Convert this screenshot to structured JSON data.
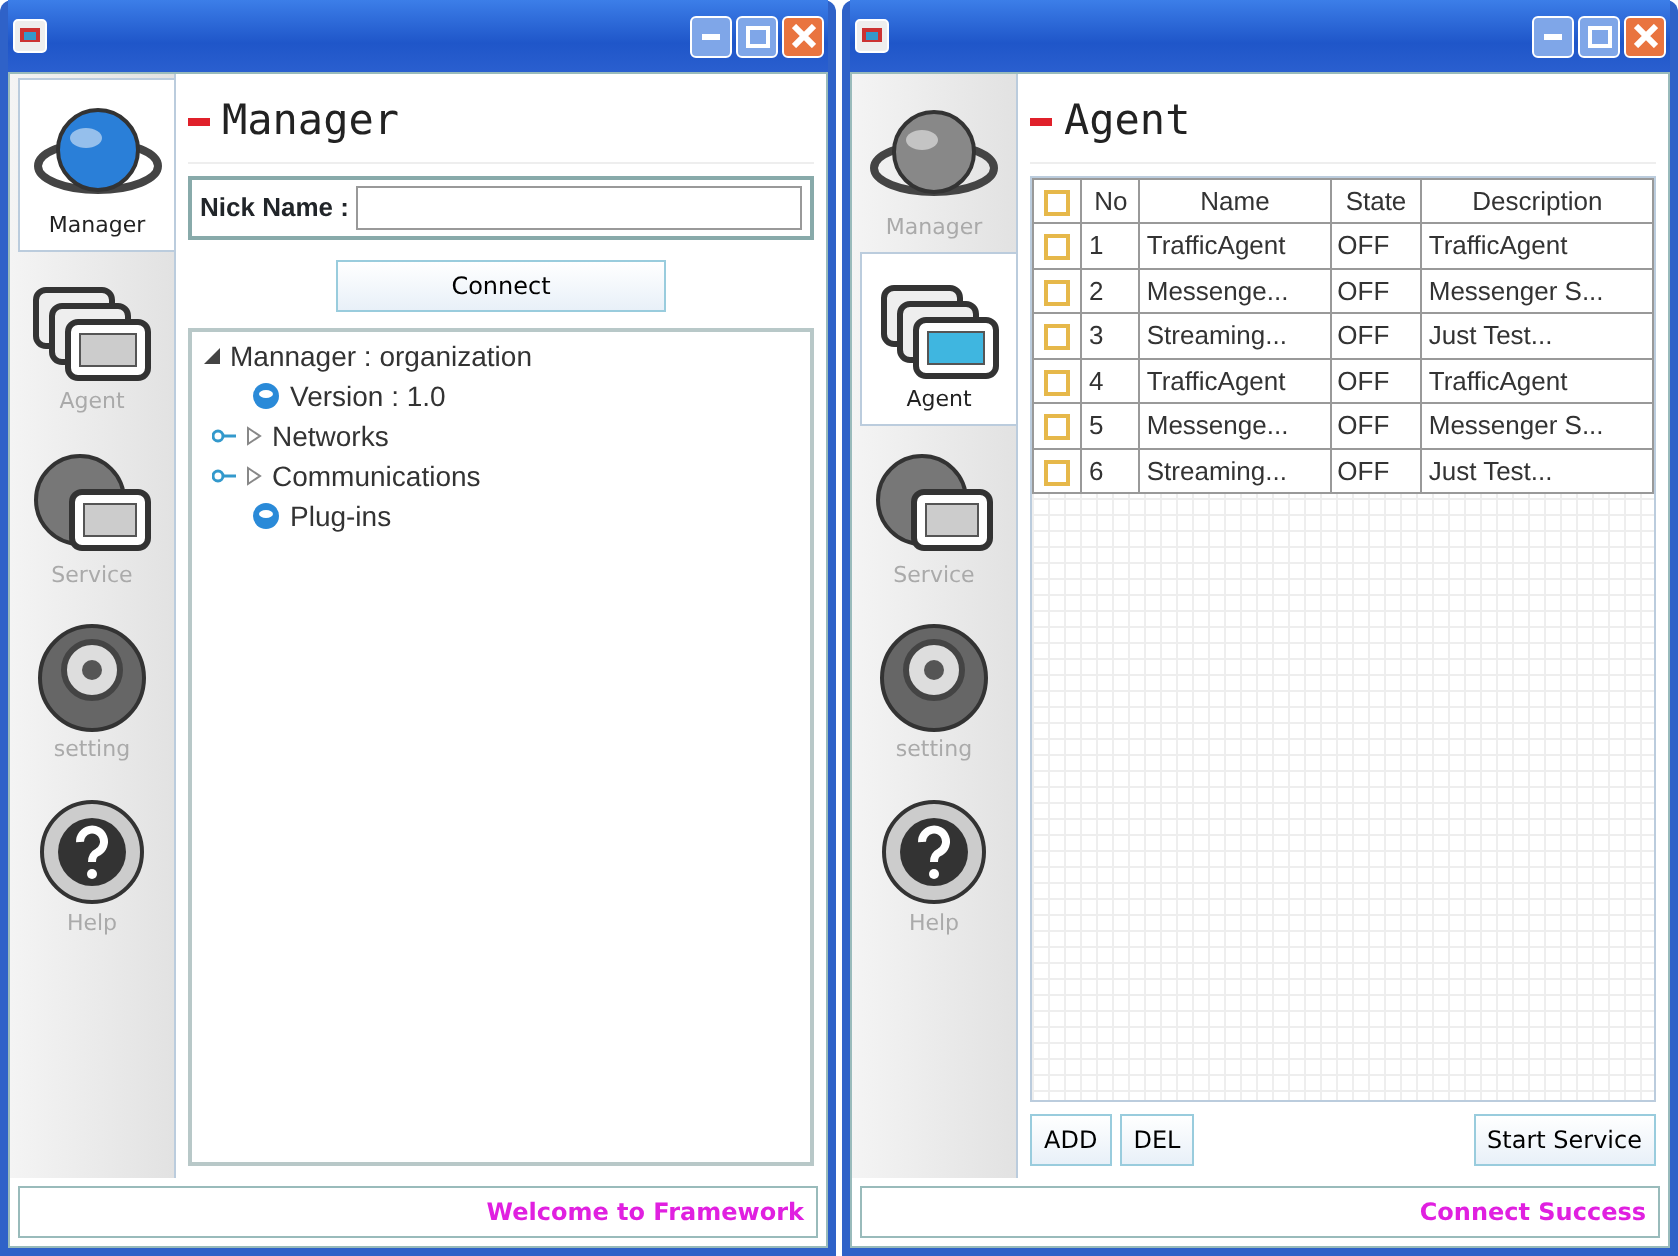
{
  "windows": [
    {
      "sidebar": [
        {
          "label": "Manager",
          "selected": true
        },
        {
          "label": "Agent",
          "selected": false
        },
        {
          "label": "Service",
          "selected": false
        },
        {
          "label": "setting",
          "selected": false
        },
        {
          "label": "Help",
          "selected": false
        }
      ],
      "panel": {
        "kind": "manager",
        "title": "Manager",
        "nick_label": "Nick Name :",
        "connect": "Connect",
        "tree": [
          {
            "label": "Mannager : organization",
            "kind": "root",
            "expanded": true,
            "children": [
              {
                "label": "Version : 1.0",
                "kind": "leaf"
              },
              {
                "label": "Networks",
                "kind": "folder",
                "expanded": false
              },
              {
                "label": "Communications",
                "kind": "folder",
                "expanded": false
              },
              {
                "label": "Plug-ins",
                "kind": "leaf"
              }
            ]
          }
        ]
      },
      "status": "Welcome to Framework"
    },
    {
      "sidebar": [
        {
          "label": "Manager",
          "selected": false
        },
        {
          "label": "Agent",
          "selected": true
        },
        {
          "label": "Service",
          "selected": false
        },
        {
          "label": "setting",
          "selected": false
        },
        {
          "label": "Help",
          "selected": false
        }
      ],
      "panel": {
        "kind": "agent",
        "title": "Agent",
        "all_checked": false,
        "columns": [
          "No",
          "Name",
          "State",
          "Description"
        ],
        "rows": [
          {
            "cells": [
              "1",
              "TrafficAgent",
              "OFF",
              "TrafficAgent"
            ],
            "checked": false
          },
          {
            "cells": [
              "2",
              "Messenge...",
              "OFF",
              "Messenger S..."
            ],
            "checked": false
          },
          {
            "cells": [
              "3",
              "Streaming...",
              "OFF",
              "Just Test..."
            ],
            "checked": false
          },
          {
            "cells": [
              "4",
              "TrafficAgent",
              "OFF",
              "TrafficAgent"
            ],
            "checked": false
          },
          {
            "cells": [
              "5",
              "Messenge...",
              "OFF",
              "Messenger S..."
            ],
            "checked": false
          },
          {
            "cells": [
              "6",
              "Streaming...",
              "OFF",
              "Just Test..."
            ],
            "checked": false
          }
        ],
        "buttons_left": [
          "ADD",
          "DEL"
        ],
        "button_right": "Start Service"
      },
      "status": "Connect Success"
    }
  ]
}
